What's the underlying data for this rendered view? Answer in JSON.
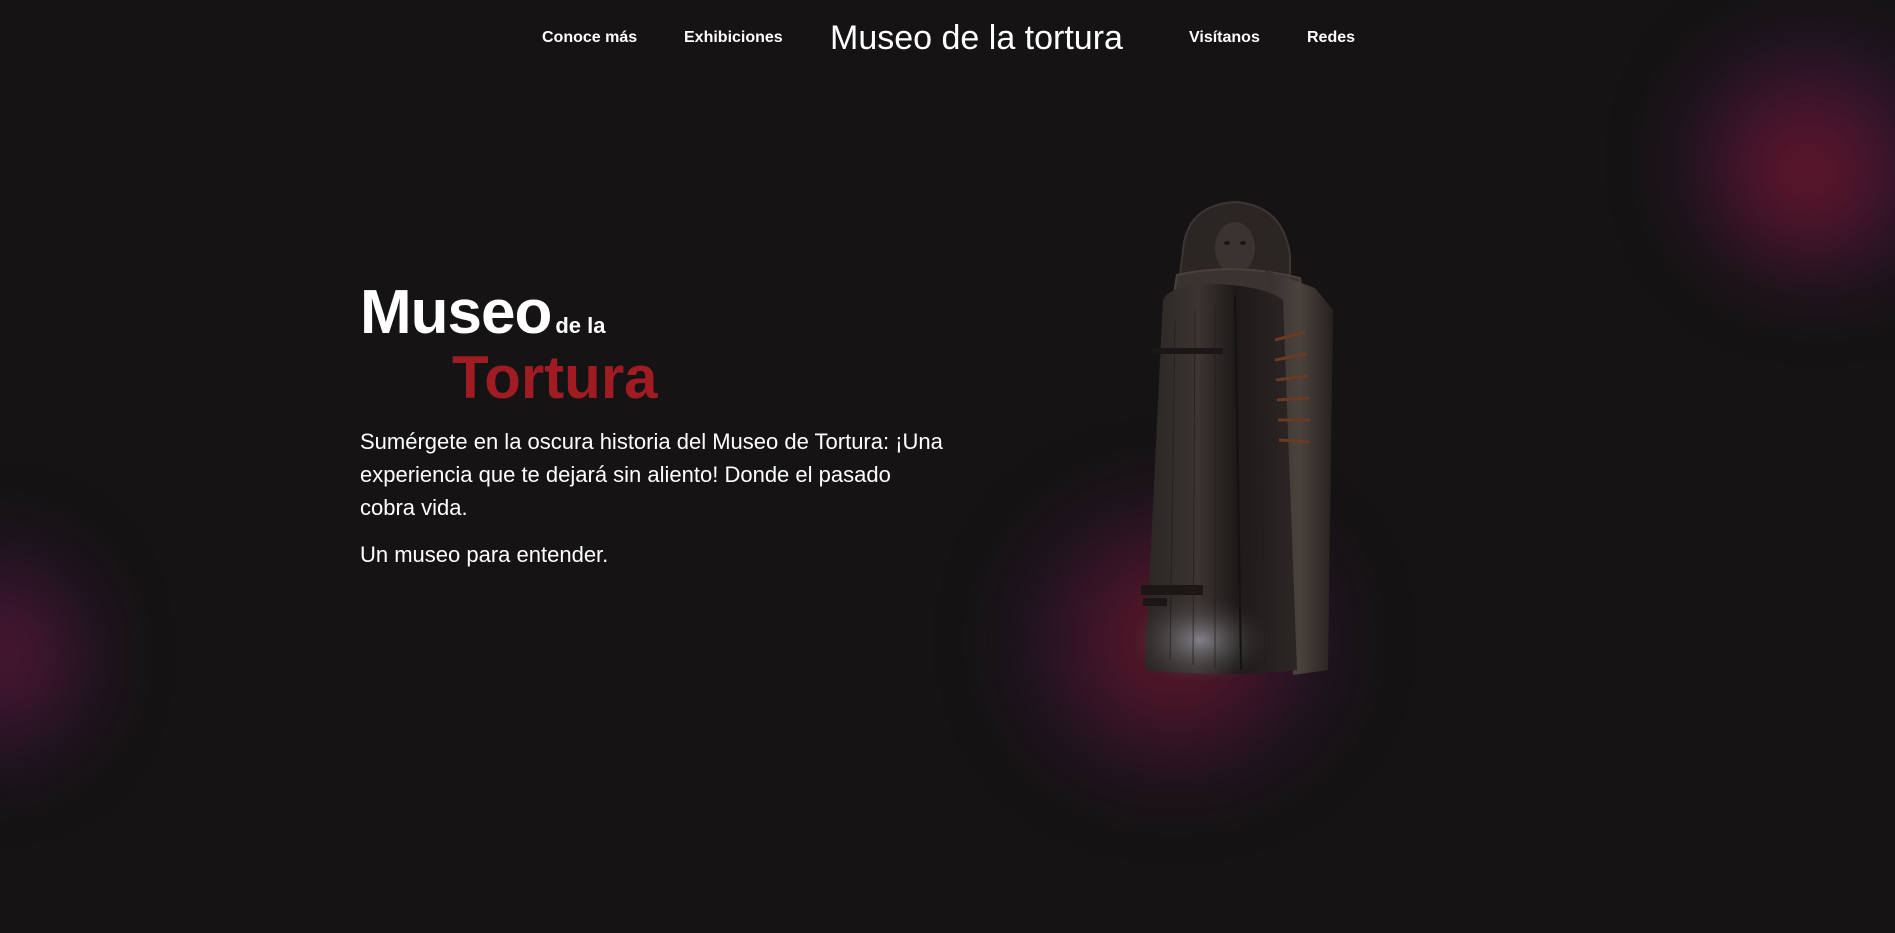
{
  "nav": {
    "items_left": [
      {
        "label": "Conoce más"
      },
      {
        "label": "Exhibiciones"
      }
    ],
    "brand": "Museo de la tortura",
    "items_right": [
      {
        "label": "Visítanos"
      },
      {
        "label": "Redes"
      }
    ]
  },
  "hero": {
    "title_main": "Museo",
    "title_small": "de la",
    "title_red": "Tortura",
    "description": "Sumérgete en la oscura historia del Museo de Tortura: ¡Una experiencia que te dejará sin aliento! Donde el pasado cobra vida.",
    "tagline": "Un museo para entender.",
    "image_icon": "iron-maiden-sculpture"
  },
  "colors": {
    "background": "#151314",
    "text": "#ffffff",
    "accent_red": "#a11c22",
    "glow_red": "#8c182c",
    "glow_purple": "#501e6e"
  }
}
